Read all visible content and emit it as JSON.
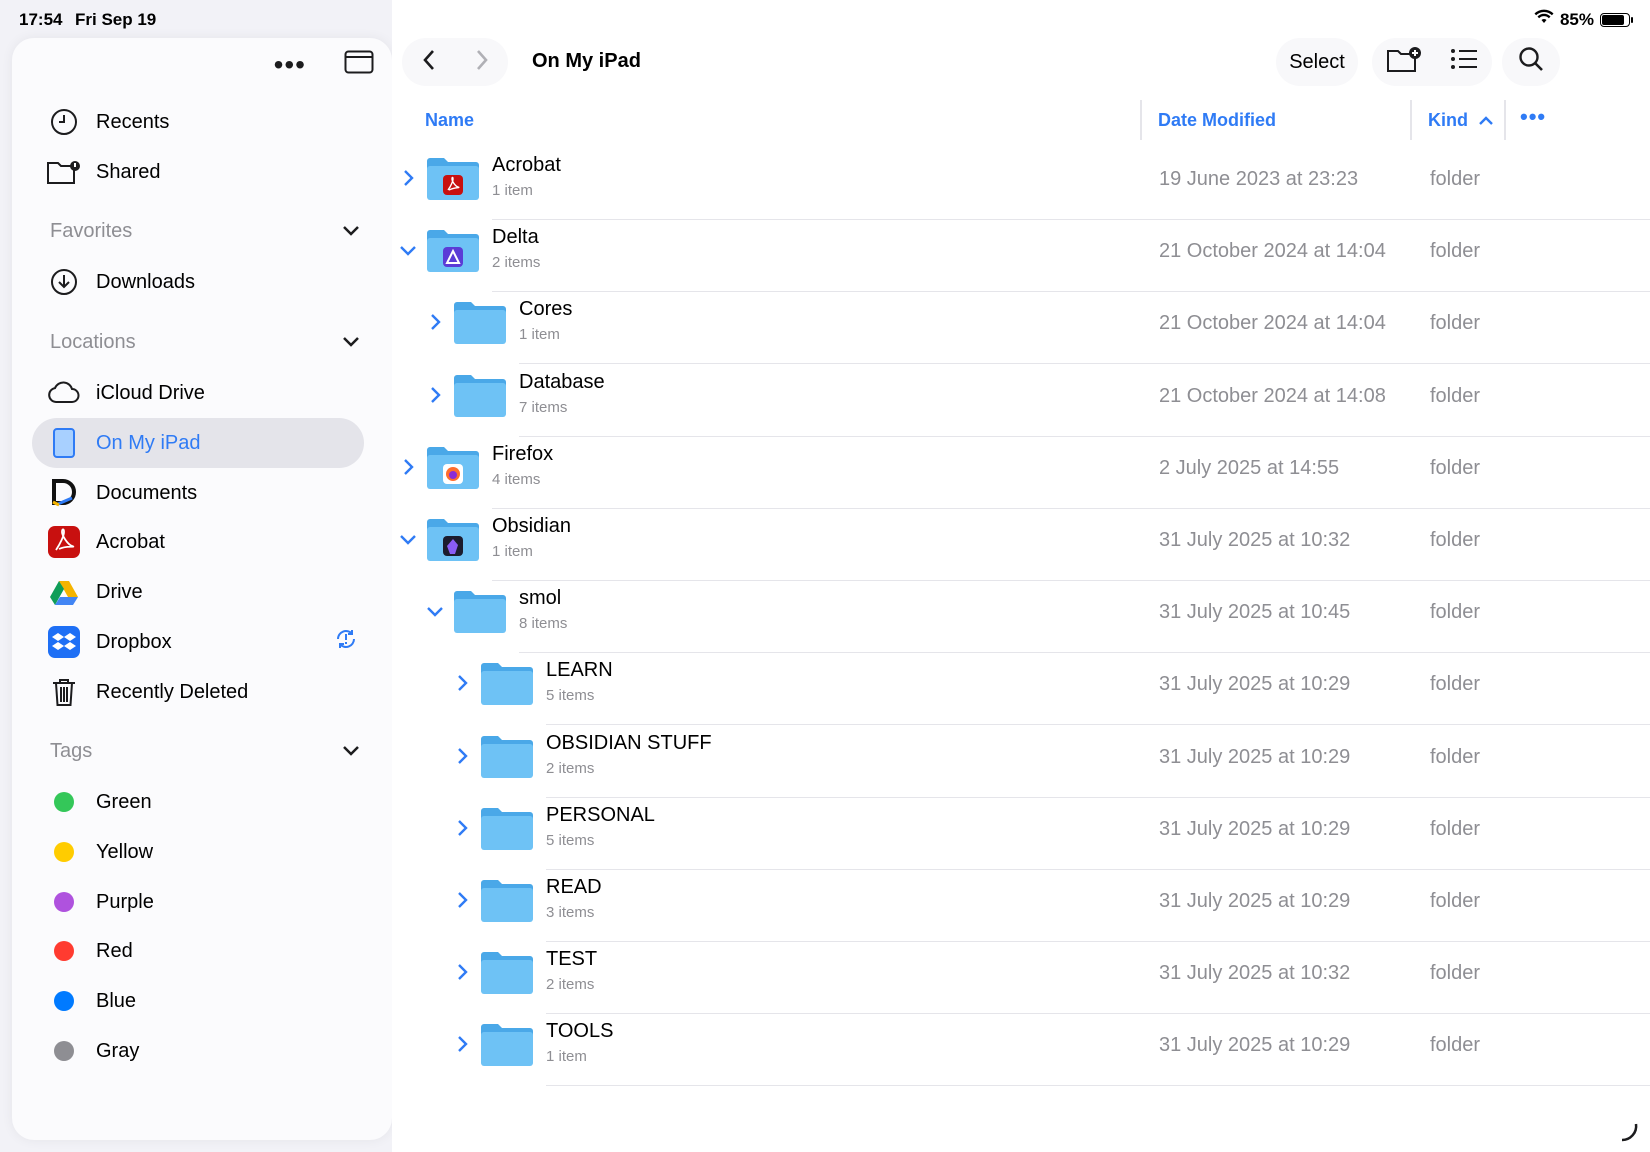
{
  "status": {
    "time": "17:54",
    "date": "Fri Sep 19",
    "battery": "85%"
  },
  "sidebar": {
    "top_items": [
      {
        "label": "Recents",
        "icon": "clock-icon"
      },
      {
        "label": "Shared",
        "icon": "shared-folder-icon"
      }
    ],
    "favorites": {
      "title": "Favorites",
      "items": [
        {
          "label": "Downloads",
          "icon": "download-icon"
        }
      ]
    },
    "locations": {
      "title": "Locations",
      "items": [
        {
          "label": "iCloud Drive",
          "icon": "cloud-icon"
        },
        {
          "label": "On My iPad",
          "icon": "ipad-icon",
          "selected": true
        },
        {
          "label": "Documents",
          "icon": "documents-app-icon"
        },
        {
          "label": "Acrobat",
          "icon": "acrobat-app-icon"
        },
        {
          "label": "Drive",
          "icon": "google-drive-icon"
        },
        {
          "label": "Dropbox",
          "icon": "dropbox-app-icon"
        },
        {
          "label": "Recently Deleted",
          "icon": "trash-icon"
        }
      ]
    },
    "tags": {
      "title": "Tags",
      "items": [
        {
          "label": "Green",
          "color": "#34c759"
        },
        {
          "label": "Yellow",
          "color": "#ffcc00"
        },
        {
          "label": "Purple",
          "color": "#af52de"
        },
        {
          "label": "Red",
          "color": "#ff3b30"
        },
        {
          "label": "Blue",
          "color": "#007aff"
        },
        {
          "label": "Gray",
          "color": "#8e8e93"
        }
      ]
    }
  },
  "toolbar": {
    "title": "On My iPad",
    "select_label": "Select"
  },
  "columns": {
    "name": "Name",
    "date": "Date Modified",
    "kind": "Kind"
  },
  "rows": [
    {
      "name": "Acrobat",
      "count": "1 item",
      "date": "19 June 2023 at 23:23",
      "kind": "folder",
      "badge": "acrobat-badge-icon"
    },
    {
      "name": "Delta",
      "count": "2 items",
      "date": "21 October 2024 at 14:04",
      "kind": "folder",
      "badge": "delta-badge-icon"
    },
    {
      "name": "Cores",
      "count": "1 item",
      "date": "21 October 2024 at 14:04",
      "kind": "folder"
    },
    {
      "name": "Database",
      "count": "7 items",
      "date": "21 October 2024 at 14:08",
      "kind": "folder"
    },
    {
      "name": "Firefox",
      "count": "4 items",
      "date": "2 July 2025 at 14:55",
      "kind": "folder",
      "badge": "firefox-badge-icon"
    },
    {
      "name": "Obsidian",
      "count": "1 item",
      "date": "31 July 2025 at 10:32",
      "kind": "folder",
      "badge": "obsidian-badge-icon"
    },
    {
      "name": "smol",
      "count": "8 items",
      "date": "31 July 2025 at 10:45",
      "kind": "folder"
    },
    {
      "name": "LEARN",
      "count": "5 items",
      "date": "31 July 2025 at 10:29",
      "kind": "folder"
    },
    {
      "name": "OBSIDIAN STUFF",
      "count": "2 items",
      "date": "31 July 2025 at 10:29",
      "kind": "folder"
    },
    {
      "name": "PERSONAL",
      "count": "5 items",
      "date": "31 July 2025 at 10:29",
      "kind": "folder"
    },
    {
      "name": "READ",
      "count": "3 items",
      "date": "31 July 2025 at 10:29",
      "kind": "folder"
    },
    {
      "name": "TEST",
      "count": "2 items",
      "date": "31 July 2025 at 10:32",
      "kind": "folder"
    },
    {
      "name": "TOOLS",
      "count": "1 item",
      "date": "31 July 2025 at 10:29",
      "kind": "folder"
    }
  ]
}
